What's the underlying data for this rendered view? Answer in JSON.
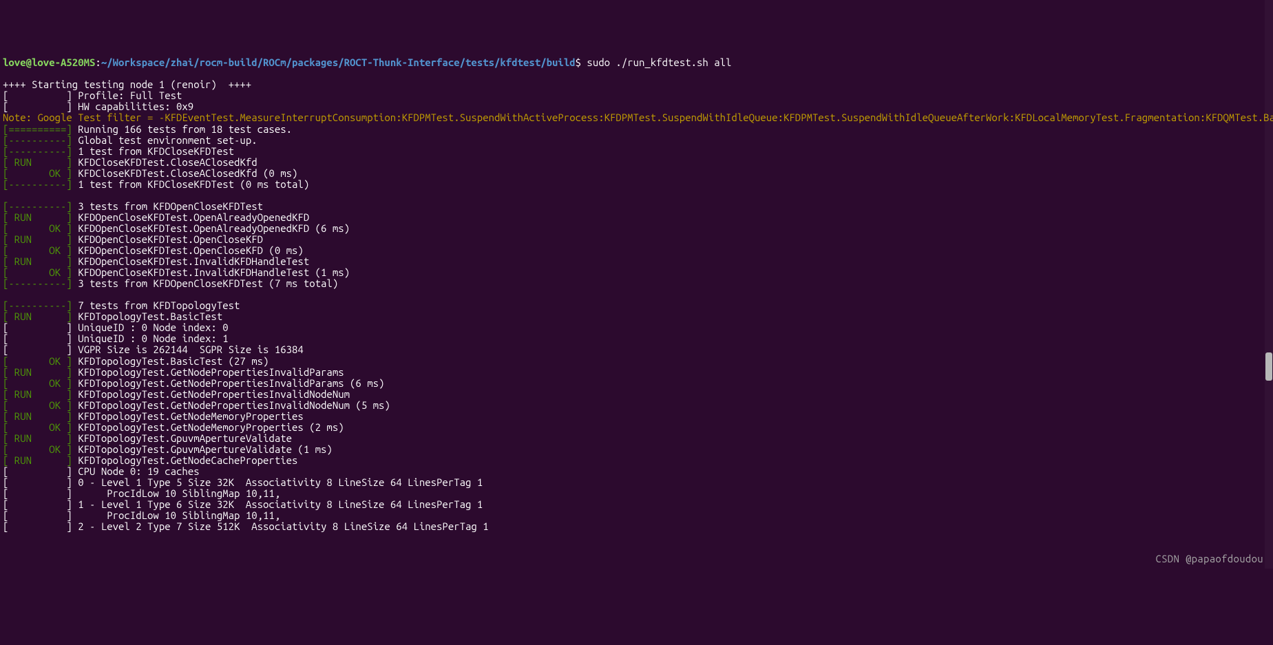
{
  "prompt": {
    "user": "love@love-A520MS",
    "sep": ":",
    "path": "~/Workspace/zhai/rocm-build/ROCm/packages/ROCT-Thunk-Interface/tests/kfdtest/build",
    "dollar": "$",
    "command": " sudo ./run_kfdtest.sh all"
  },
  "blank1": "",
  "start_line": "++++ Starting testing node 1 (renoir)  ++++",
  "profile_line": "[          ] Profile: Full Test",
  "hwcap_line": "[          ] HW capabilities: 0x9",
  "note": "Note: Google Test filter = -KFDEventTest.MeasureInterruptConsumption:KFDPMTest.SuspendWithActiveProcess:KFDPMTest.SuspendWithIdleQueue:KFDPMTest.SuspendWithIdleQueueAfterWork:KFDLocalMemoryTest.Fragmentation:KFDQMTest.BasicCuMaskingLinear:KFDQMTest.BasicCuMaskingEven:RDMATest.GPUDirect:KFDRASTest.*:KFDLocalMemoryTest.CheckZeroInitializationVram:KFDQMTest.GPUDoorbellWrite:KFDQMTest.mGPUShareBO:KFDQMTest.SdmaEventInterrupt:KFDMemoryTest.CacheInvalidateOnRemoteWrite:KFDEvictTest.BurstyTest:KFDHWSTest.*:KFDSVMRangeTest.ReadOnlyRangeTest*:KFDDBGTest.SuspendQueues:KFDDBGTest.HitAddressWatch:KFDEvictTest.*:KFDMemoryTest.LargestSysBufferTest:KFDMemoryTest.SignalHandling",
  "lines": [
    {
      "prefix": "[==========]",
      "pcolor": "green",
      "text": " Running 166 tests from 18 test cases."
    },
    {
      "prefix": "[----------]",
      "pcolor": "green",
      "text": " Global test environment set-up."
    },
    {
      "prefix": "[----------]",
      "pcolor": "green",
      "text": " 1 test from KFDCloseKFDTest"
    },
    {
      "prefix": "[ RUN      ]",
      "pcolor": "green",
      "text": " KFDCloseKFDTest.CloseAClosedKfd"
    },
    {
      "prefix": "[       OK ]",
      "pcolor": "green",
      "text": " KFDCloseKFDTest.CloseAClosedKfd (0 ms)"
    },
    {
      "prefix": "[----------]",
      "pcolor": "green",
      "text": " 1 test from KFDCloseKFDTest (0 ms total)"
    },
    {
      "prefix": "",
      "pcolor": "none",
      "text": ""
    },
    {
      "prefix": "[----------]",
      "pcolor": "green",
      "text": " 3 tests from KFDOpenCloseKFDTest"
    },
    {
      "prefix": "[ RUN      ]",
      "pcolor": "green",
      "text": " KFDOpenCloseKFDTest.OpenAlreadyOpenedKFD"
    },
    {
      "prefix": "[       OK ]",
      "pcolor": "green",
      "text": " KFDOpenCloseKFDTest.OpenAlreadyOpenedKFD (6 ms)"
    },
    {
      "prefix": "[ RUN      ]",
      "pcolor": "green",
      "text": " KFDOpenCloseKFDTest.OpenCloseKFD"
    },
    {
      "prefix": "[       OK ]",
      "pcolor": "green",
      "text": " KFDOpenCloseKFDTest.OpenCloseKFD (0 ms)"
    },
    {
      "prefix": "[ RUN      ]",
      "pcolor": "green",
      "text": " KFDOpenCloseKFDTest.InvalidKFDHandleTest"
    },
    {
      "prefix": "[       OK ]",
      "pcolor": "green",
      "text": " KFDOpenCloseKFDTest.InvalidKFDHandleTest (1 ms)"
    },
    {
      "prefix": "[----------]",
      "pcolor": "green",
      "text": " 3 tests from KFDOpenCloseKFDTest (7 ms total)"
    },
    {
      "prefix": "",
      "pcolor": "none",
      "text": ""
    },
    {
      "prefix": "[----------]",
      "pcolor": "green",
      "text": " 7 tests from KFDTopologyTest"
    },
    {
      "prefix": "[ RUN      ]",
      "pcolor": "green",
      "text": " KFDTopologyTest.BasicTest"
    },
    {
      "prefix": "[          ]",
      "pcolor": "white",
      "text": " UniqueID : 0 Node index: 0"
    },
    {
      "prefix": "[          ]",
      "pcolor": "white",
      "text": " UniqueID : 0 Node index: 1"
    },
    {
      "prefix": "[          ]",
      "pcolor": "white",
      "text": " VGPR Size is 262144  SGPR Size is 16384"
    },
    {
      "prefix": "[       OK ]",
      "pcolor": "green",
      "text": " KFDTopologyTest.BasicTest (27 ms)"
    },
    {
      "prefix": "[ RUN      ]",
      "pcolor": "green",
      "text": " KFDTopologyTest.GetNodePropertiesInvalidParams"
    },
    {
      "prefix": "[       OK ]",
      "pcolor": "green",
      "text": " KFDTopologyTest.GetNodePropertiesInvalidParams (6 ms)"
    },
    {
      "prefix": "[ RUN      ]",
      "pcolor": "green",
      "text": " KFDTopologyTest.GetNodePropertiesInvalidNodeNum"
    },
    {
      "prefix": "[       OK ]",
      "pcolor": "green",
      "text": " KFDTopologyTest.GetNodePropertiesInvalidNodeNum (5 ms)"
    },
    {
      "prefix": "[ RUN      ]",
      "pcolor": "green",
      "text": " KFDTopologyTest.GetNodeMemoryProperties"
    },
    {
      "prefix": "[       OK ]",
      "pcolor": "green",
      "text": " KFDTopologyTest.GetNodeMemoryProperties (2 ms)"
    },
    {
      "prefix": "[ RUN      ]",
      "pcolor": "green",
      "text": " KFDTopologyTest.GpuvmApertureValidate"
    },
    {
      "prefix": "[       OK ]",
      "pcolor": "green",
      "text": " KFDTopologyTest.GpuvmApertureValidate (1 ms)"
    },
    {
      "prefix": "[ RUN      ]",
      "pcolor": "green",
      "text": " KFDTopologyTest.GetNodeCacheProperties"
    },
    {
      "prefix": "[          ]",
      "pcolor": "white",
      "text": " CPU Node 0: 19 caches"
    },
    {
      "prefix": "[          ]",
      "pcolor": "white",
      "text": " 0 - Level 1 Type 5 Size 32K  Associativity 8 LineSize 64 LinesPerTag 1"
    },
    {
      "prefix": "[          ]",
      "pcolor": "white",
      "text": "      ProcIdLow 10 SiblingMap 10,11,"
    },
    {
      "prefix": "[          ]",
      "pcolor": "white",
      "text": " 1 - Level 1 Type 6 Size 32K  Associativity 8 LineSize 64 LinesPerTag 1"
    },
    {
      "prefix": "[          ]",
      "pcolor": "white",
      "text": "      ProcIdLow 10 SiblingMap 10,11,"
    },
    {
      "prefix": "[          ]",
      "pcolor": "white",
      "text": " 2 - Level 2 Type 7 Size 512K  Associativity 8 LineSize 64 LinesPerTag 1"
    }
  ],
  "watermark": "CSDN @papaofdoudou",
  "scrollbar": {
    "top_pct": 62,
    "height_pct": 5
  }
}
